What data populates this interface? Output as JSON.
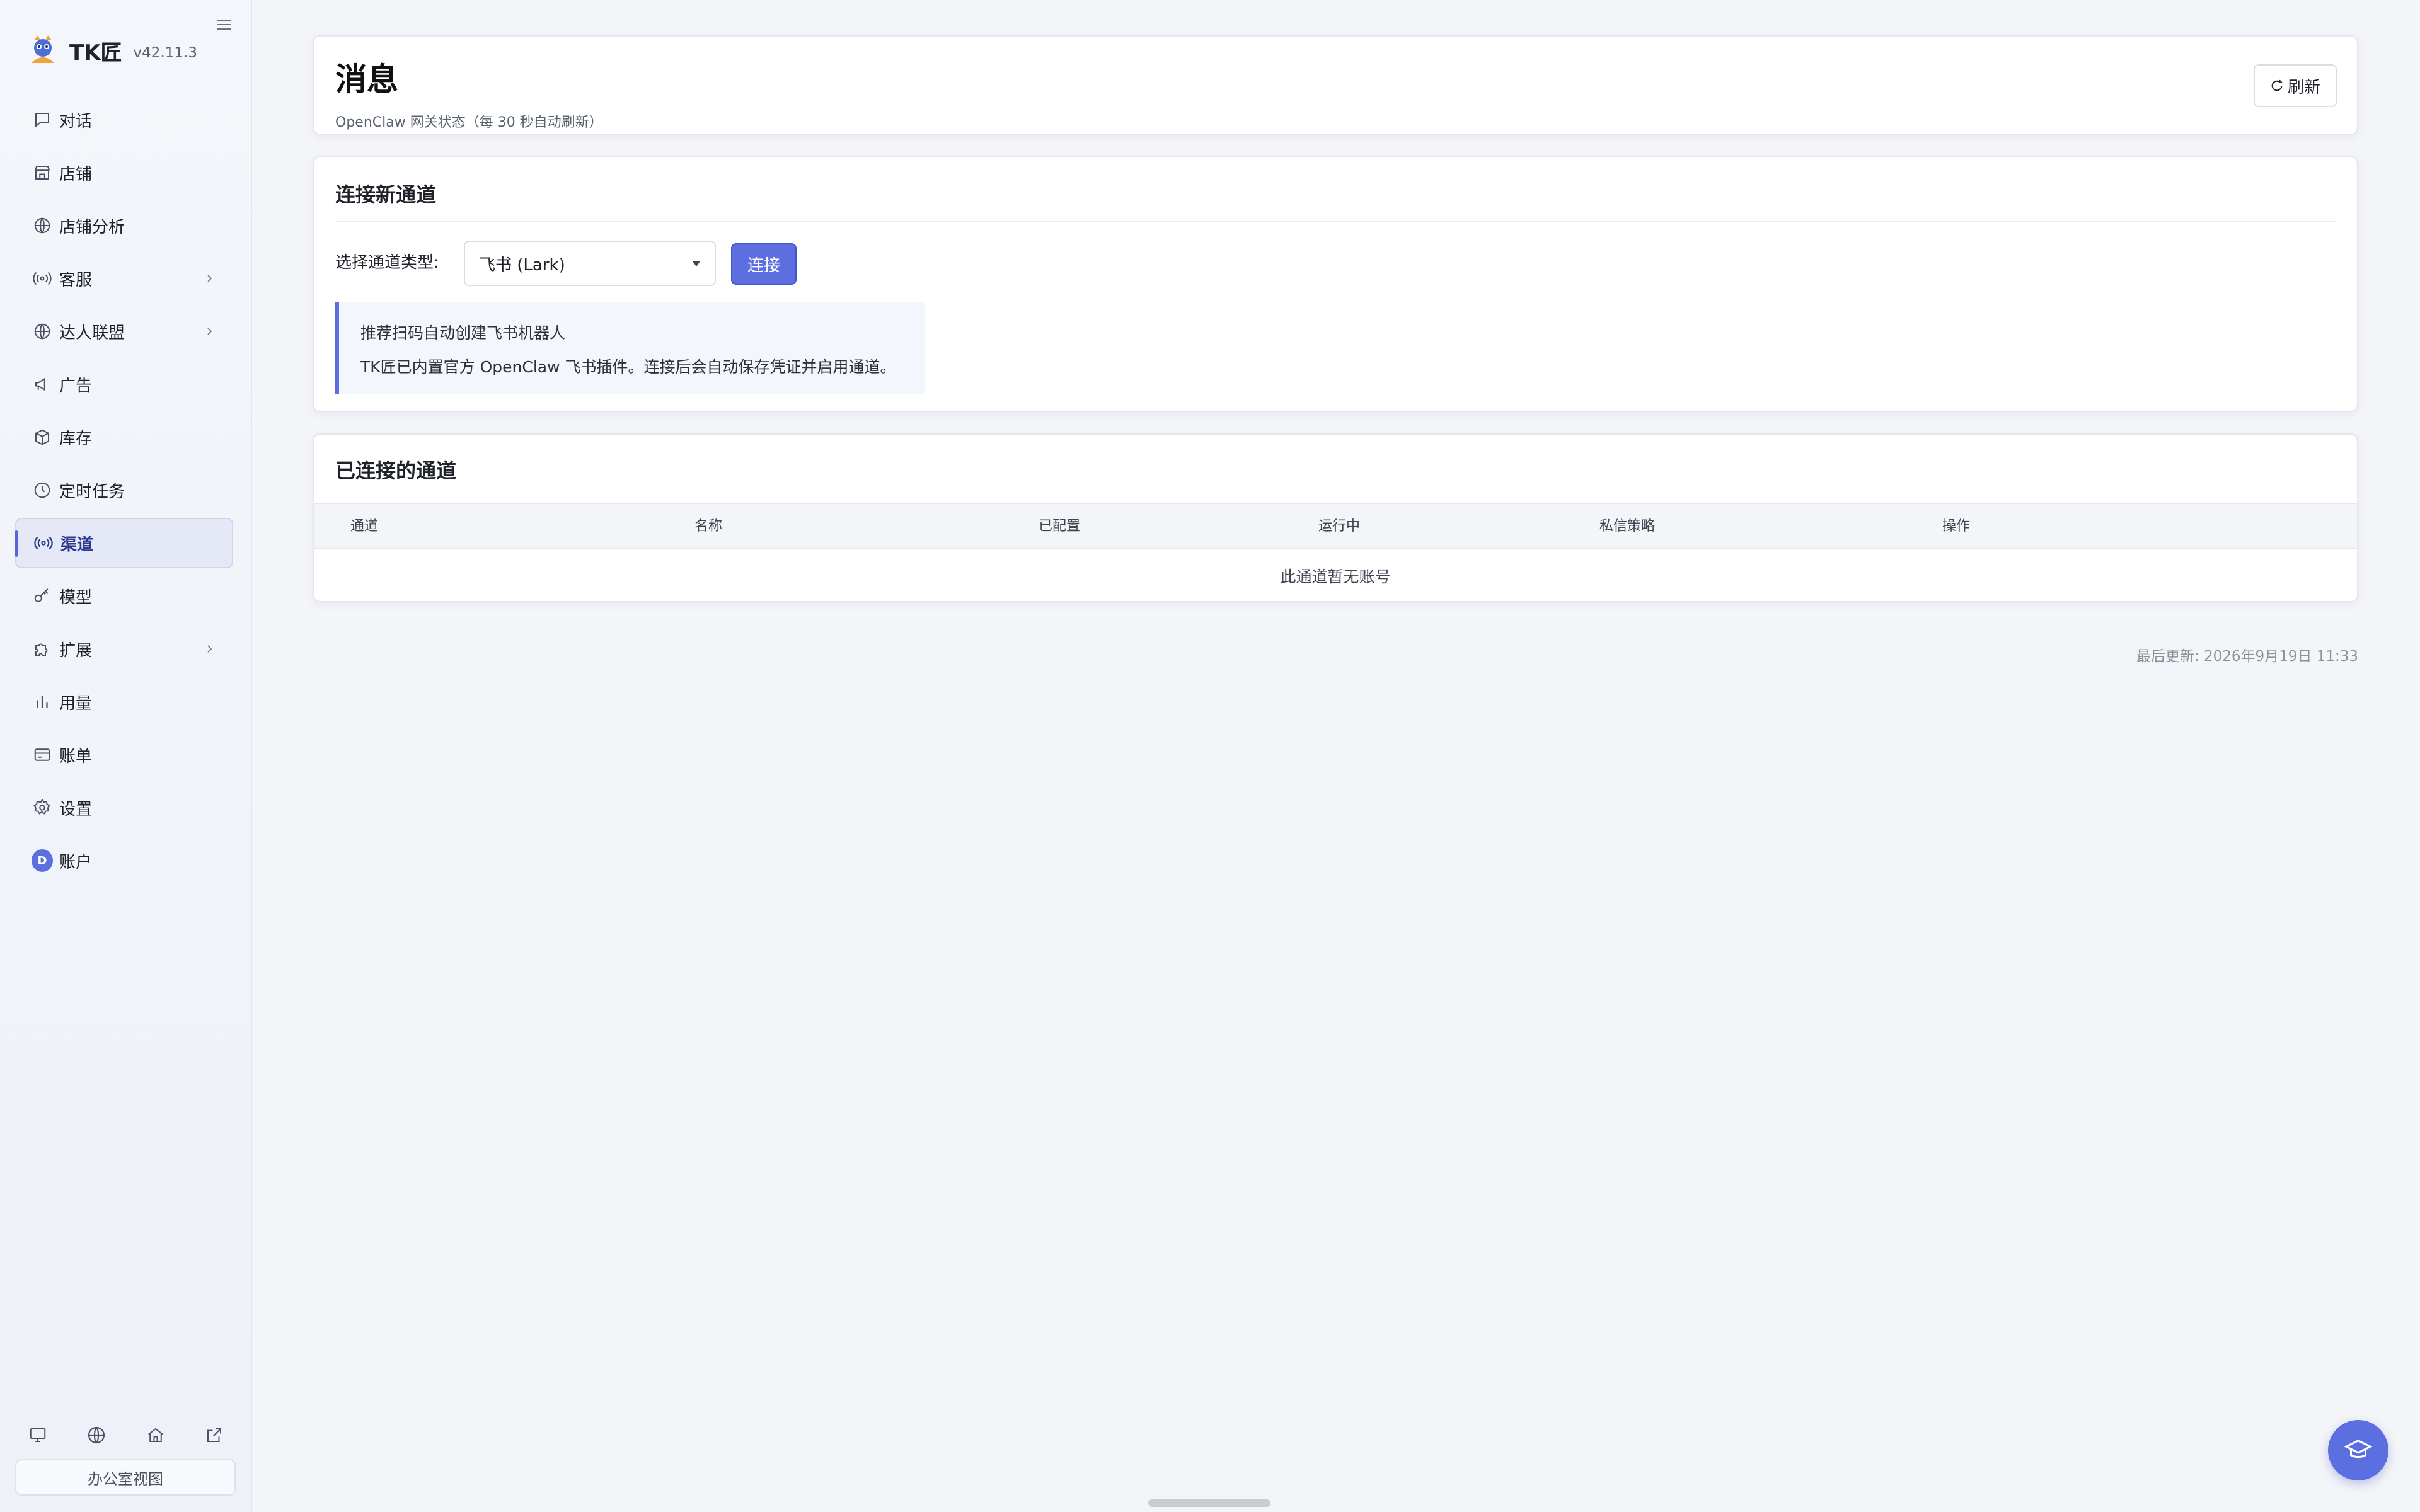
{
  "app": {
    "name": "TK匠",
    "version": "v42.11.3"
  },
  "sidebar": {
    "items": [
      {
        "label": "对话",
        "icon": "chat-icon"
      },
      {
        "label": "店铺",
        "icon": "store-icon"
      },
      {
        "label": "店铺分析",
        "icon": "globe-icon"
      },
      {
        "label": "客服",
        "icon": "radio-signal-icon",
        "has_children": true
      },
      {
        "label": "达人联盟",
        "icon": "globe-icon",
        "has_children": true
      },
      {
        "label": "广告",
        "icon": "megaphone-icon"
      },
      {
        "label": "库存",
        "icon": "box-icon"
      },
      {
        "label": "定时任务",
        "icon": "clock-icon"
      },
      {
        "label": "渠道",
        "icon": "radio-signal-icon",
        "active": true
      },
      {
        "label": "模型",
        "icon": "key-icon"
      },
      {
        "label": "扩展",
        "icon": "puzzle-icon",
        "has_children": true
      },
      {
        "label": "用量",
        "icon": "bar-chart-icon"
      },
      {
        "label": "账单",
        "icon": "credit-card-icon"
      },
      {
        "label": "设置",
        "icon": "gear-icon"
      },
      {
        "label": "账户",
        "icon": "avatar",
        "avatar_letter": "D"
      }
    ],
    "footer_icons": [
      "monitor-icon",
      "globe-icon",
      "home-icon",
      "external-link-icon"
    ],
    "office_view_label": "办公室视图"
  },
  "header": {
    "title": "消息",
    "subtitle": "OpenClaw 网关状态（每 30 秒自动刷新）",
    "refresh_label": "刷新"
  },
  "connect": {
    "title": "连接新通道",
    "select_label": "选择通道类型:",
    "selected_channel": "飞书 (Lark)",
    "connect_label": "连接",
    "tip_title": "推荐扫码自动创建飞书机器人",
    "tip_body": "TK匠已内置官方 OpenClaw 飞书插件。连接后会自动保存凭证并启用通道。"
  },
  "channels": {
    "title": "已连接的通道",
    "columns": [
      "通道",
      "名称",
      "已配置",
      "运行中",
      "私信策略",
      "操作"
    ],
    "empty_text": "此通道暂无账号"
  },
  "footer": {
    "last_updated": "最后更新: 2026年9月19日 11:33"
  },
  "colors": {
    "accent": "#5b6fe0",
    "active_bg": "#e5e9f7",
    "text": "#1f2329"
  }
}
